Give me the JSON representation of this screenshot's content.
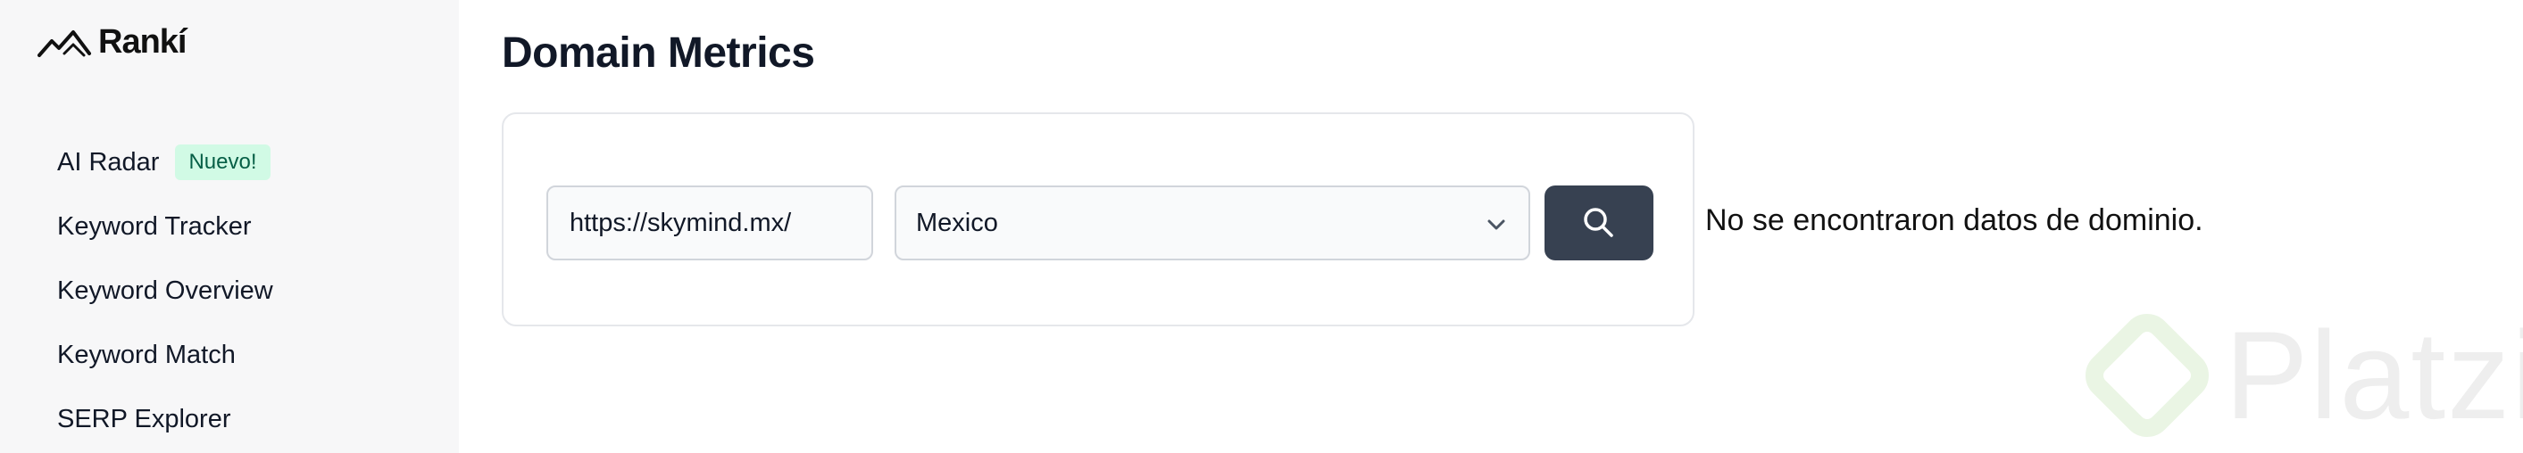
{
  "app": {
    "logo_text": "Rankí"
  },
  "sidebar": {
    "items": [
      {
        "label": "AI Radar",
        "badge": "Nuevo!"
      },
      {
        "label": "Keyword Tracker"
      },
      {
        "label": "Keyword Overview"
      },
      {
        "label": "Keyword Match"
      },
      {
        "label": "SERP Explorer"
      }
    ]
  },
  "main": {
    "title": "Domain Metrics",
    "url_input": {
      "value": "https://skymind.mx/"
    },
    "country_select": {
      "value": "Mexico"
    },
    "search_icon": "search-icon",
    "empty_message": "No se encontraron datos de dominio."
  },
  "watermark": {
    "text": "Platzi"
  },
  "colors": {
    "sidebar_bg": "#f7f7f8",
    "badge_bg": "#d1fae5",
    "badge_text": "#065f46",
    "button_bg": "#374151",
    "border": "#e5e7eb"
  }
}
